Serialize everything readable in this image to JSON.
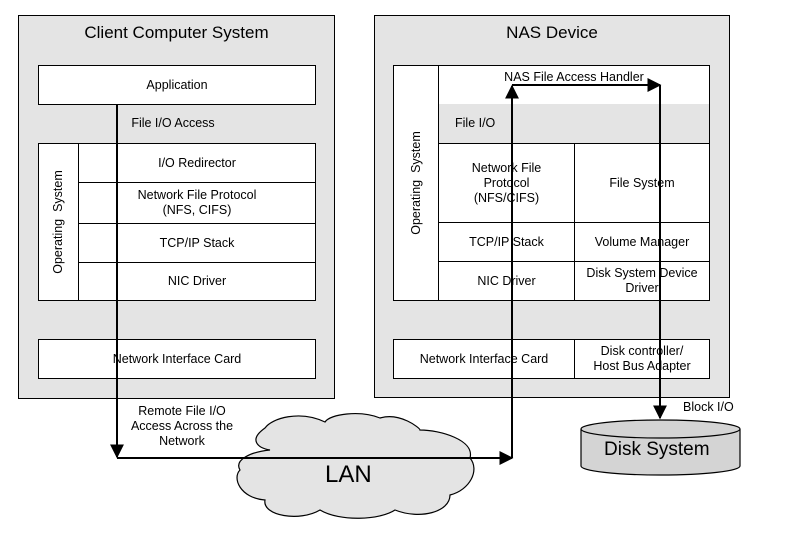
{
  "client": {
    "title": "Client Computer System",
    "application": "Application",
    "file_io_access": "File I/O Access",
    "os_label": "Operating  System",
    "layers": [
      "I/O Redirector",
      "Network File Protocol\n(NFS, CIFS)",
      "TCP/IP Stack",
      "NIC Driver"
    ],
    "nic": "Network Interface Card"
  },
  "nas": {
    "title": "NAS Device",
    "handler": "NAS File Access Handler",
    "file_io": "File I/O",
    "os_label": "Operating  System",
    "left_layers": [
      "Network File\nProtocol\n(NFS/CIFS)",
      "TCP/IP Stack",
      "NIC Driver"
    ],
    "right_layers": [
      "File System",
      "Volume Manager",
      "Disk System Device\nDriver"
    ],
    "nic": "Network Interface Card",
    "hba": "Disk controller/\nHost Bus Adapter"
  },
  "network": {
    "remote_label": "Remote File I/O\nAccess Across the\nNetwork",
    "lan": "LAN"
  },
  "storage": {
    "block_io": "Block I/O",
    "disk": "Disk System"
  },
  "colors": {
    "container_fill": "#e4e4e4",
    "disk_fill": "#d4d4d4",
    "line": "#000000"
  }
}
